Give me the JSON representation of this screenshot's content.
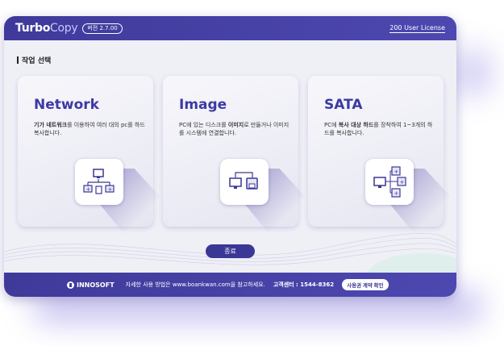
{
  "header": {
    "logo_turbo": "Turbo",
    "logo_copy": "Copy",
    "version": "버전 2.7.00",
    "license": "200 User License"
  },
  "section": {
    "title": "작업 선택"
  },
  "cards": [
    {
      "title": "Network",
      "desc_bold": "기가 네트워크",
      "desc_rest": "를 이용하여 여러 대의 pc를 하드 복사합니다."
    },
    {
      "title": "Image",
      "desc_pre": "PC에 있는 디스크를 ",
      "desc_bold": "이미지",
      "desc_rest": "로 만들거나 이미지를 시스템에 연결합니다."
    },
    {
      "title": "SATA",
      "desc_pre": "PC에 ",
      "desc_bold": "복사 대상 하드",
      "desc_rest": "를 장착하여 1~3개의 하드를 복사합니다."
    }
  ],
  "buttons": {
    "close": "종료",
    "license_agreement": "사용권 계약 확인"
  },
  "footer": {
    "brand": "INNOSOFT",
    "help": "자세한 사용 방법은 www.boankwan.com을 참고하세요.",
    "contact": "고객센터 : 1544-8362"
  },
  "icons": {
    "card1": "network-computers-icon",
    "card2": "computer-to-disk-icon",
    "card3": "computer-to-drives-icon",
    "brand": "innosoft-logo-icon"
  },
  "colors": {
    "brand": "#3f3a9a",
    "accent": "#3c3aa2"
  }
}
